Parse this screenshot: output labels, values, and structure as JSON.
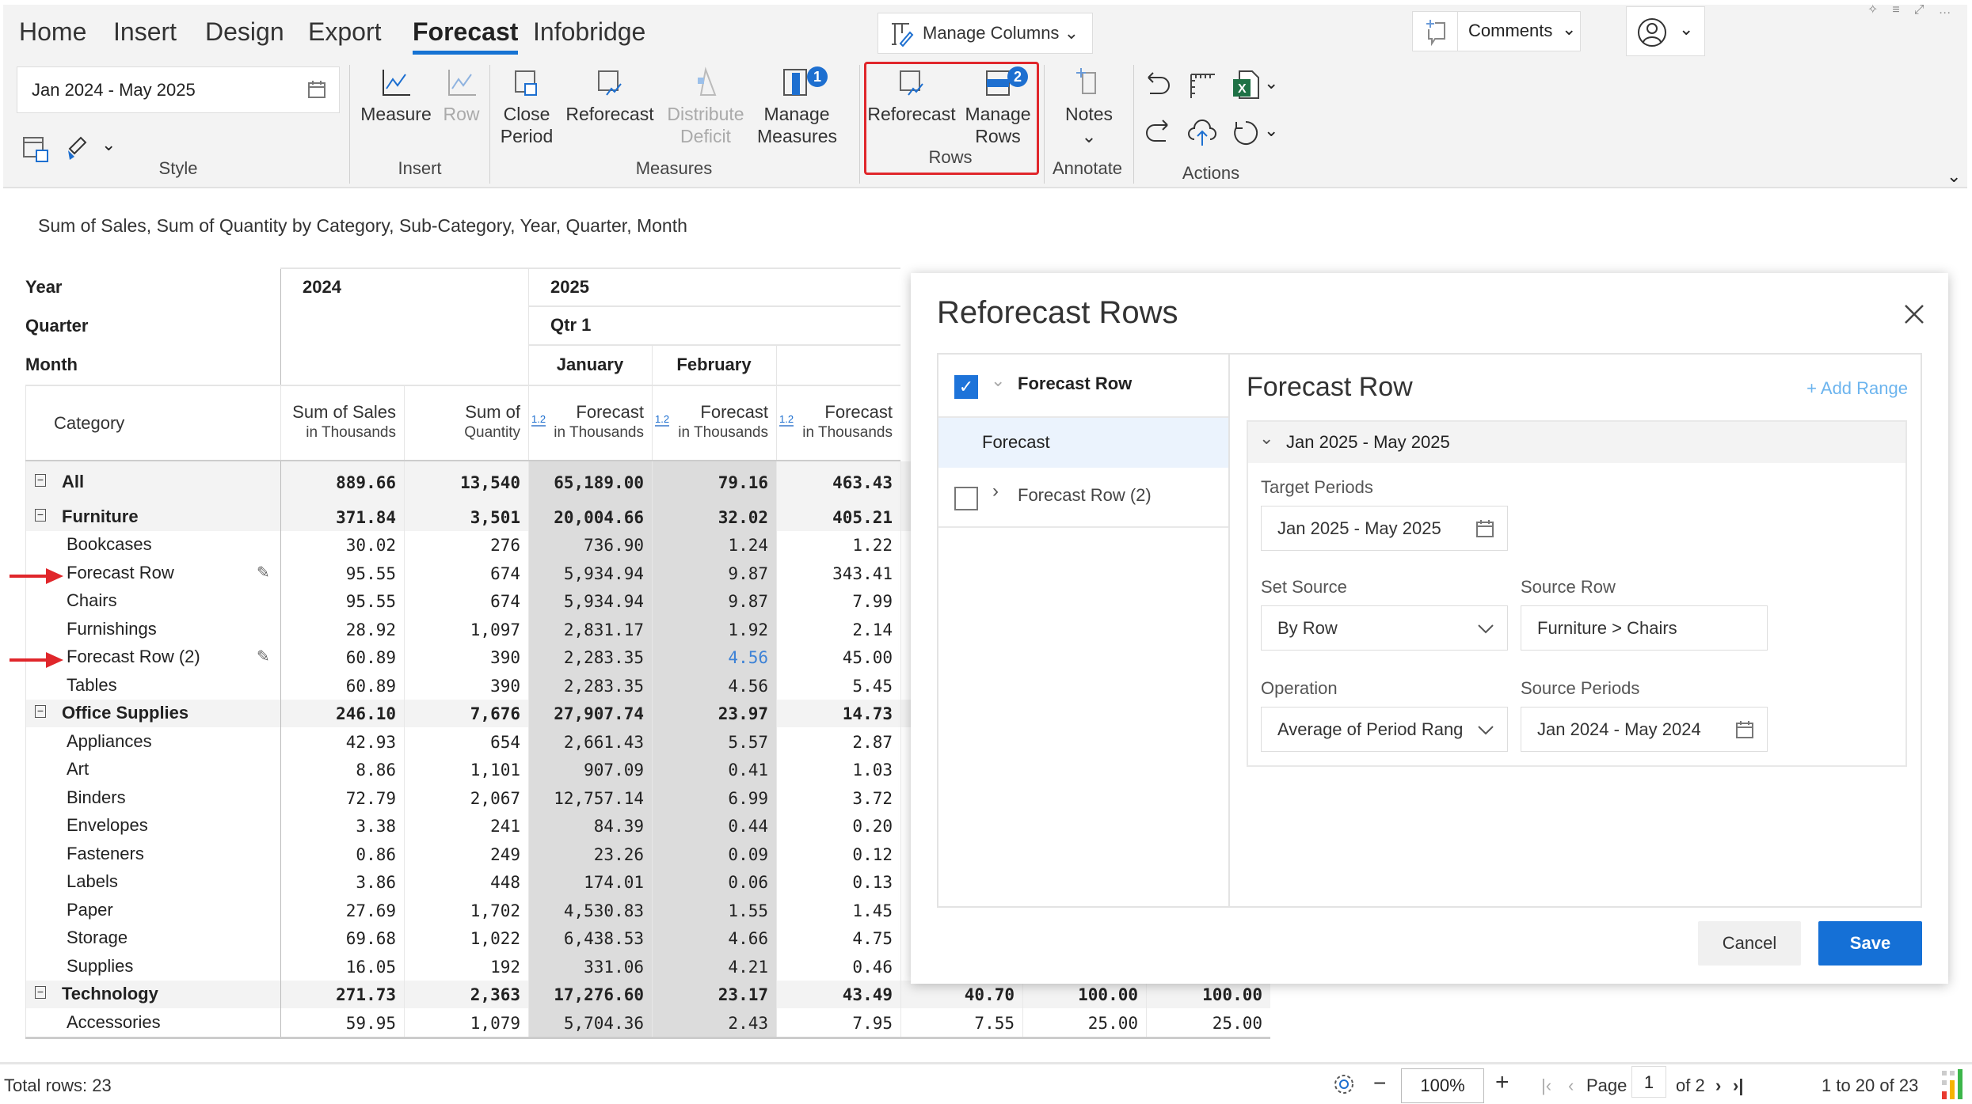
{
  "tabs": [
    "Home",
    "Insert",
    "Design",
    "Export",
    "Forecast",
    "Infobridge"
  ],
  "active_tab": "Forecast",
  "ribbon": {
    "date_range": "Jan 2024 - May 2025",
    "manage_columns": "Manage Columns",
    "comments": "Comments",
    "groups": {
      "style": "Style",
      "insert": "Insert",
      "measures": "Measures",
      "rows": "Rows",
      "annotate": "Annotate",
      "actions": "Actions"
    },
    "buttons": {
      "measure": "Measure",
      "row": "Row",
      "close_period": [
        "Close",
        "Period"
      ],
      "reforecast": "Reforecast",
      "distribute_deficit": [
        "Distribute",
        "Deficit"
      ],
      "manage_measures": [
        "Manage",
        "Measures"
      ],
      "manage_measures_badge": "1",
      "rows_reforecast": "Reforecast",
      "manage_rows": [
        "Manage",
        "Rows"
      ],
      "manage_rows_badge": "2",
      "notes": "Notes"
    },
    "highlight_color": "#e0262b"
  },
  "subtitle": "Sum of Sales, Sum of Quantity by Category, Sub-Category, Year, Quarter, Month",
  "table": {
    "dim_labels": [
      "Year",
      "Quarter",
      "Month"
    ],
    "year_2024": "2024",
    "year_2025": "2025",
    "quarter": "Qtr 1",
    "months": [
      "January",
      "February"
    ],
    "category_header": "Category",
    "measure_headers": [
      [
        "Sum of Sales",
        "in Thousands"
      ],
      [
        "Sum of",
        "Quantity"
      ],
      [
        "Forecast",
        "in Thousands"
      ],
      [
        "Forecast",
        "in Thousands"
      ],
      [
        "Forecast",
        "in Thousands"
      ]
    ],
    "decimal_icon": "1.2",
    "rows": [
      {
        "label": "All",
        "level": 0,
        "group": true,
        "values": [
          "889.66",
          "13,540",
          "65,189.00",
          "79.16",
          "463.43"
        ]
      },
      {
        "label": "Furniture",
        "level": 0,
        "group": true,
        "values": [
          "371.84",
          "3,501",
          "20,004.66",
          "32.02",
          "405.21"
        ]
      },
      {
        "label": "Bookcases",
        "level": 1,
        "values": [
          "30.02",
          "276",
          "736.90",
          "1.24",
          "1.22"
        ]
      },
      {
        "label": "Forecast Row",
        "level": 1,
        "edit": true,
        "arrow": true,
        "values": [
          "95.55",
          "674",
          "5,934.94",
          "9.87",
          "343.41"
        ]
      },
      {
        "label": "Chairs",
        "level": 1,
        "values": [
          "95.55",
          "674",
          "5,934.94",
          "9.87",
          "7.99"
        ]
      },
      {
        "label": "Furnishings",
        "level": 1,
        "values": [
          "28.92",
          "1,097",
          "2,831.17",
          "1.92",
          "2.14"
        ]
      },
      {
        "label": "Forecast Row (2)",
        "level": 1,
        "edit": true,
        "arrow": true,
        "blue_col": 3,
        "values": [
          "60.89",
          "390",
          "2,283.35",
          "4.56",
          "45.00"
        ]
      },
      {
        "label": "Tables",
        "level": 1,
        "values": [
          "60.89",
          "390",
          "2,283.35",
          "4.56",
          "5.45"
        ]
      },
      {
        "label": "Office Supplies",
        "level": 0,
        "group": true,
        "values": [
          "246.10",
          "7,676",
          "27,907.74",
          "23.97",
          "14.73"
        ]
      },
      {
        "label": "Appliances",
        "level": 1,
        "values": [
          "42.93",
          "654",
          "2,661.43",
          "5.57",
          "2.87"
        ]
      },
      {
        "label": "Art",
        "level": 1,
        "values": [
          "8.86",
          "1,101",
          "907.09",
          "0.41",
          "1.03"
        ]
      },
      {
        "label": "Binders",
        "level": 1,
        "values": [
          "72.79",
          "2,067",
          "12,757.14",
          "6.99",
          "3.72"
        ]
      },
      {
        "label": "Envelopes",
        "level": 1,
        "values": [
          "3.38",
          "241",
          "84.39",
          "0.44",
          "0.20"
        ]
      },
      {
        "label": "Fasteners",
        "level": 1,
        "values": [
          "0.86",
          "249",
          "23.26",
          "0.09",
          "0.12"
        ]
      },
      {
        "label": "Labels",
        "level": 1,
        "values": [
          "3.86",
          "448",
          "174.01",
          "0.06",
          "0.13"
        ]
      },
      {
        "label": "Paper",
        "level": 1,
        "values": [
          "27.69",
          "1,702",
          "4,530.83",
          "1.55",
          "1.45"
        ]
      },
      {
        "label": "Storage",
        "level": 1,
        "values": [
          "69.68",
          "1,022",
          "6,438.53",
          "4.66",
          "4.75"
        ]
      },
      {
        "label": "Supplies",
        "level": 1,
        "values": [
          "16.05",
          "192",
          "331.06",
          "4.21",
          "0.46"
        ]
      },
      {
        "label": "Technology",
        "level": 0,
        "group": true,
        "values": [
          "271.73",
          "2,363",
          "17,276.60",
          "23.17",
          "43.49",
          "40.70",
          "100.00",
          "100.00"
        ]
      },
      {
        "label": "Accessories",
        "level": 1,
        "values": [
          "59.95",
          "1,079",
          "5,704.36",
          "2.43",
          "7.95",
          "7.55",
          "25.00",
          "25.00"
        ]
      }
    ]
  },
  "dialog": {
    "title": "Reforecast Rows",
    "list": [
      {
        "label": "Forecast Row",
        "checked": true,
        "expanded": true
      },
      {
        "label": "Forecast",
        "child": true
      },
      {
        "label": "Forecast Row (2)",
        "checked": false,
        "expanded": false
      }
    ],
    "detail_title": "Forecast Row",
    "add_range": "+ Add Range",
    "range_header": "Jan 2025 - May 2025",
    "target_periods_label": "Target Periods",
    "target_periods": "Jan 2025 - May 2025",
    "set_source_label": "Set Source",
    "set_source": "By Row",
    "source_row_label": "Source Row",
    "source_row": "Furniture > Chairs",
    "operation_label": "Operation",
    "operation": "Average of Period Rang",
    "source_periods_label": "Source Periods",
    "source_periods": "Jan 2024 - May 2024",
    "cancel": "Cancel",
    "save": "Save"
  },
  "footer": {
    "total_rows": "Total rows: 23",
    "zoom": "100%",
    "page_label": "Page",
    "page": "1",
    "of_pages": "of 2",
    "range": "1 to 20 of 23"
  }
}
